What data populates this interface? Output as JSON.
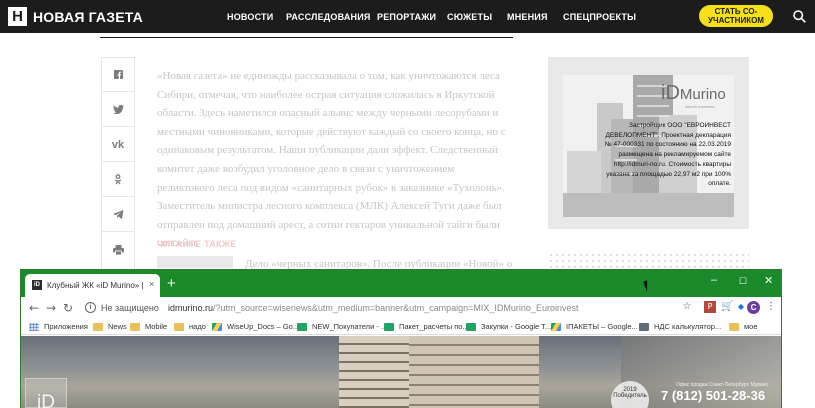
{
  "site": {
    "logo_letter": "Н",
    "logo_text": "НОВАЯ ГАЗЕТА",
    "nav": [
      "НОВОСТИ",
      "РАССЛЕДОВАНИЯ",
      "РЕПОРТАЖИ",
      "СЮЖЕТЫ",
      "МНЕНИЯ",
      "СПЕЦПРОЕКТЫ"
    ],
    "cta_line1": "СТАТЬ СО-",
    "cta_line2": "УЧАСТНИКОМ",
    "cta_color": "#f5e11a"
  },
  "share_icons": [
    "facebook-icon",
    "twitter-icon",
    "vk-icon",
    "odnoklassniki-icon",
    "telegram-icon",
    "print-icon"
  ],
  "article": {
    "text": "«Новая газета» не единожды рассказывала о том, как уничтожаются леса Сибири, отмечая, что наиболее острая ситуация сложилась в Иркутской области. Здесь наметился опасный альянс между черными лесорубами и местными чиновниками, которые действуют каждый со своего конца, но с одинаковым результатом. Наши публикации дали эффект. Следственный комитет даже возбудил уголовное дело в связи с уничтожением реликтового леса под видом «санитарных рубок» в заказнике «Тухолонь». Заместитель министра лесного комплекса (МЛК) Алексей Туги даже был отправлен под домашний арест, а сотни гектаров уникальной тайги были спасены.",
    "also_title": "ЧИТАЙТЕ ТАКЖЕ",
    "also_text": "Дело «черных санитаров». После публикации «Новой» о"
  },
  "ad": {
    "brand": "Murino",
    "brand_prefix": "iD",
    "brand_sub": "жилой комплекс",
    "text": "Застройщик ООО \"ЕВРОИНВЕСТ ДЕВЕЛОПМЕНТ\". Проектная декларация № 47-000331 по состоянию на 22.03.2019 размещена на рекламируемом сайте http://idmuri-no.ru. Стоимость квартиры указана за площадью 22,97 м2 при 100% оплате."
  },
  "chrome": {
    "tab_title": "Клубный ЖК «iD Murino» | iD M",
    "tab_close": "×",
    "new_tab": "+",
    "window_controls": [
      "–",
      "☐",
      "✕"
    ],
    "security_label": "Не защищено",
    "url_host": "idmurino.ru",
    "url_rest": "/?utm_source=wisenews&utm_medium=banner&utm_campaign=MIX_IDMurino_Euroinvest",
    "avatar_letter": "C",
    "bookmarks": [
      {
        "label": "Приложения",
        "icon": "apps-icon"
      },
      {
        "label": "News",
        "icon": "folder-icon"
      },
      {
        "label": "Mobile",
        "icon": "folder-icon"
      },
      {
        "label": "надо",
        "icon": "folder-icon"
      },
      {
        "label": "WiseUp_Docs – Go...",
        "icon": "drive-icon"
      },
      {
        "label": "NEW_Покупатели - ...",
        "icon": "sheets-icon"
      },
      {
        "label": "Пакет_расчеты по...",
        "icon": "sheets-icon"
      },
      {
        "label": "Закупки - Google T...",
        "icon": "sheets-icon"
      },
      {
        "label": "IПАКЕТЫ – Google...",
        "icon": "drive-icon"
      },
      {
        "label": "НДС калькулятор...",
        "icon": "calc-icon"
      },
      {
        "label": "мое",
        "icon": "folder-icon"
      }
    ],
    "page": {
      "logo": "iD",
      "badge_year": "2019",
      "badge_text": "Победитель",
      "phone_caption": "Офис продаж Санкт-Петербург, Мурино",
      "phone": "7 (812) 501-28-36"
    }
  },
  "colors": {
    "header_bg": "#1c1c1c",
    "chrome_titlebar": "#1b8a2a",
    "article_text": "#c5c5c5"
  }
}
